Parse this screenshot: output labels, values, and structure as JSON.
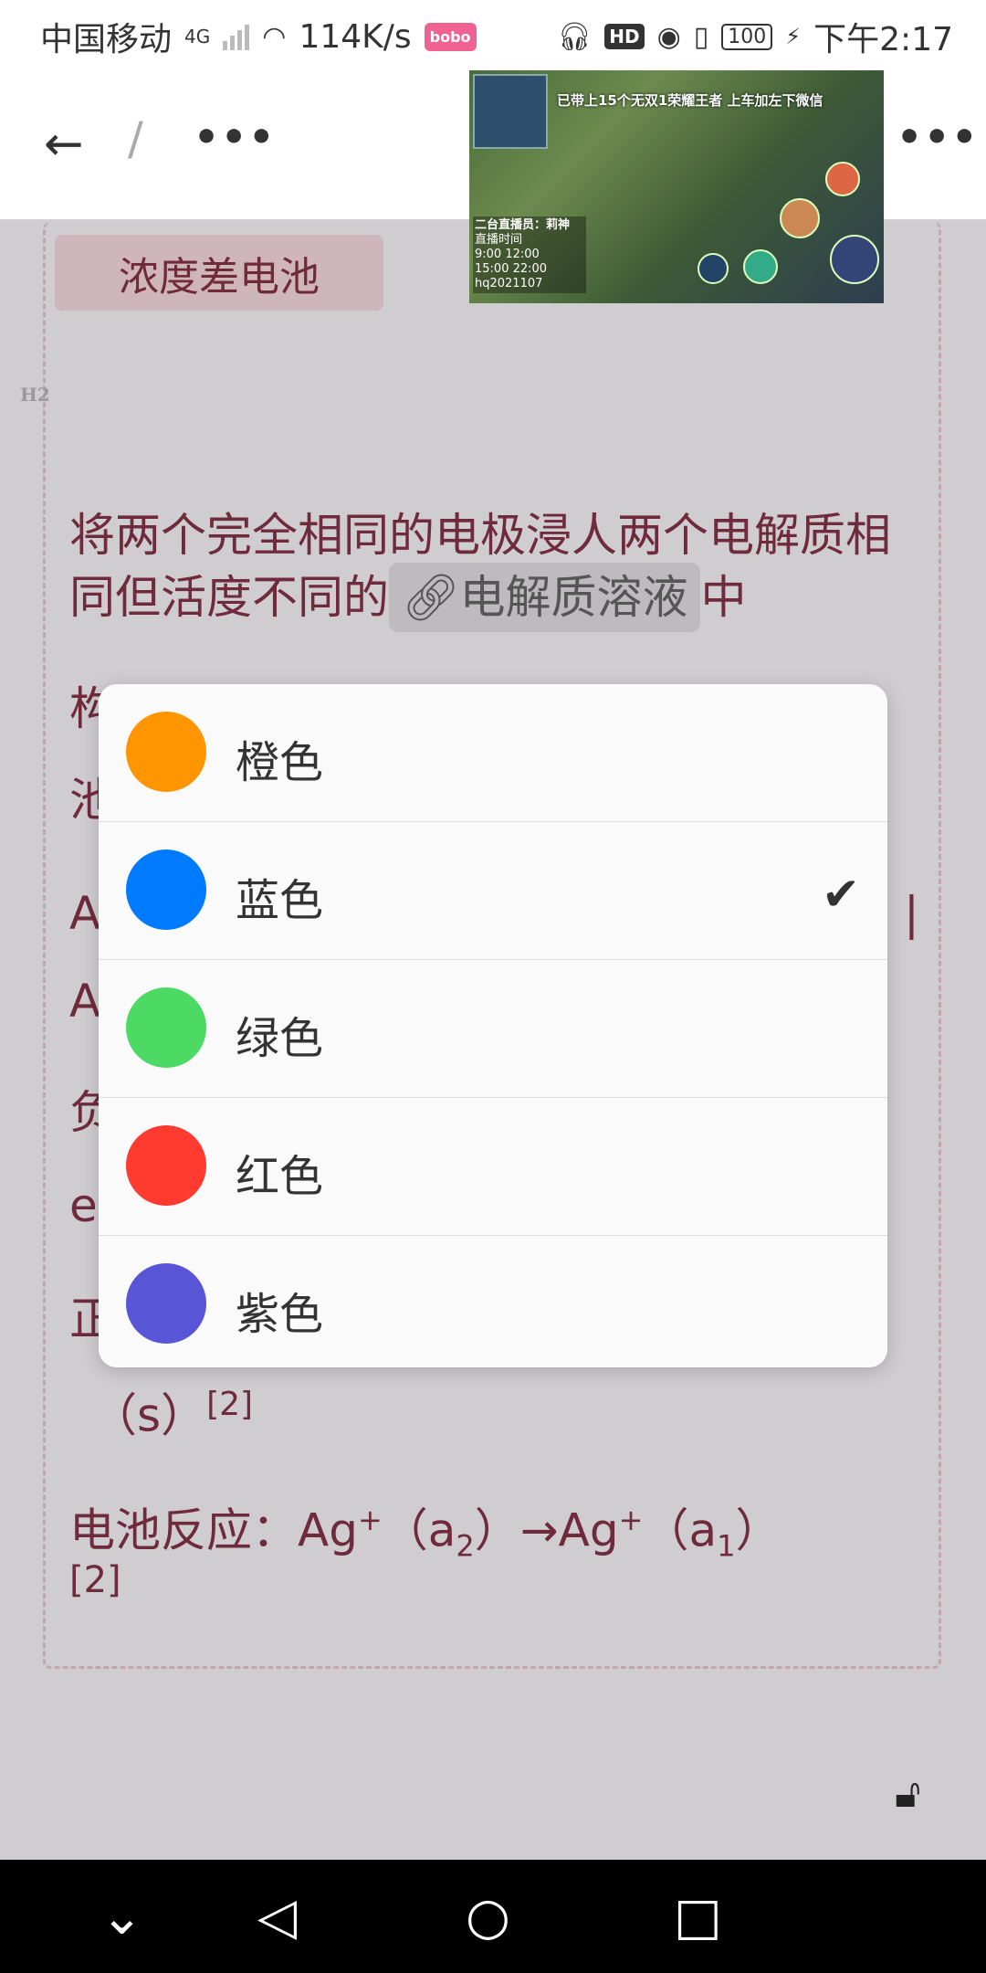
{
  "status_bar": {
    "carrier": "中国移动",
    "network": "4G",
    "speed": "114K/s",
    "app_badge": "bobo",
    "hd": "HD",
    "battery": "100",
    "time": "下午2:17"
  },
  "toolbar": {
    "back_icon": "arrow-left",
    "separator": "/",
    "more_icon": "more-horizontal"
  },
  "video": {
    "banner": "已带上15个无双1荣耀王者 上车加左下微信",
    "streamer": "二台直播员：莉神",
    "schedule": [
      "直播时间",
      "9:00  12:00",
      "15:00  22:00"
    ],
    "handle": "hq2021107"
  },
  "content": {
    "tag": "浓度差电池",
    "h2_marker": "H2",
    "para1_before": "将两个完全相同的电极浸人两个电解质相同但活度不同的",
    "link_text": "电解质溶液",
    "para1_after": "中",
    "frag_l1": "构",
    "frag_l2": "池",
    "frag_l3": "A",
    "frag_l4": "A",
    "frag_l5": "负",
    "frag_l6": "e",
    "frag_l7": "正",
    "frag_r": "|",
    "s_line": "（s）",
    "cite": "[2]",
    "reaction_label": "电池反应：",
    "reaction_ag1": "Ag",
    "reaction_sup": "+",
    "reaction_a2": "a",
    "reaction_sub2": "2",
    "reaction_arrow": "→",
    "reaction_ag2": "Ag",
    "reaction_a1": "a",
    "reaction_sub1": "1",
    "reaction_cite": "[2]"
  },
  "color_picker": {
    "options": [
      {
        "label": "橙色",
        "color": "#ff9500",
        "selected": false
      },
      {
        "label": "蓝色",
        "color": "#007aff",
        "selected": true
      },
      {
        "label": "绿色",
        "color": "#4cd964",
        "selected": false
      },
      {
        "label": "红色",
        "color": "#ff3b30",
        "selected": false
      },
      {
        "label": "紫色",
        "color": "#5856d6",
        "selected": false
      }
    ],
    "check_icon": "checkmark"
  },
  "lock_icon": "unlock",
  "nav_bar": [
    "collapse",
    "back",
    "home",
    "recents"
  ]
}
